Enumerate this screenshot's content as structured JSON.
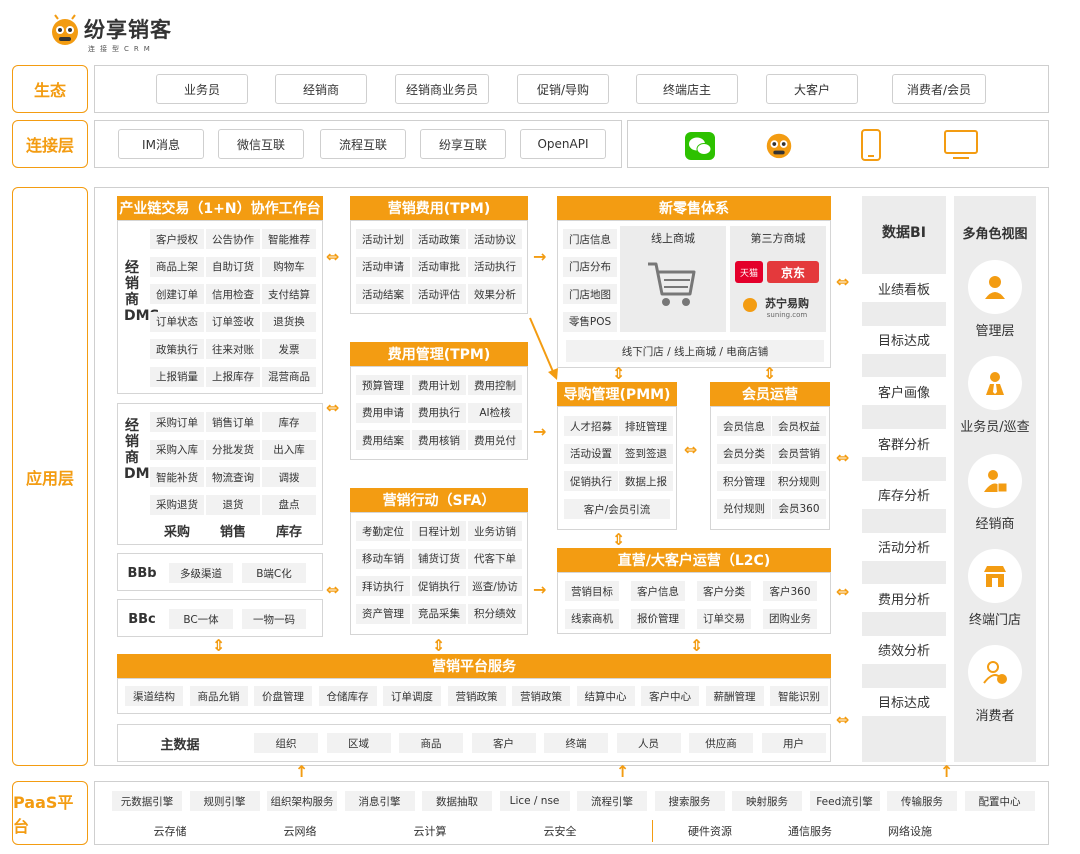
{
  "logo": {
    "name": "纷享销客",
    "sub": "连接型CRM"
  },
  "lanes": {
    "eco": "生态",
    "conn": "连接层",
    "app": "应用层",
    "paas": "PaaS平台"
  },
  "eco": [
    "业务员",
    "经销商",
    "经销商业务员",
    "促销/导购",
    "终端店主",
    "大客户",
    "消费者/会员"
  ],
  "conn": [
    "IM消息",
    "微信互联",
    "流程互联",
    "纷享互联",
    "OpenAPI"
  ],
  "conn_icons": [
    "wechat-icon",
    "mascot-icon",
    "mobile-icon",
    "monitor-icon"
  ],
  "chain": {
    "title": "产业链交易（1+N）协作工作台",
    "dms_label": "经销商DMS",
    "grid1": [
      "客户授权",
      "公告协作",
      "智能推荐",
      "商品上架",
      "自助订货",
      "购物车",
      "创建订单",
      "信用检查",
      "支付结算",
      "订单状态",
      "订单签收",
      "退货换",
      "政策执行",
      "往来对账",
      "发票",
      "上报销量",
      "上报库存",
      "混营商品"
    ],
    "grid2": [
      "采购订单",
      "销售订单",
      "库存",
      "采购入库",
      "分批发货",
      "出入库",
      "智能补货",
      "物流查询",
      "调拨",
      "采购退货",
      "退货",
      "盘点"
    ],
    "grid2_foot": [
      "采购",
      "销售",
      "库存"
    ],
    "bbb": {
      "label": "BBb",
      "items": [
        "多级渠道",
        "B端C化"
      ]
    },
    "bbc": {
      "label": "BBc",
      "items": [
        "BC一体",
        "一物一码"
      ]
    }
  },
  "tpm": {
    "title": "营销费用(TPM)",
    "items": [
      "活动计划",
      "活动政策",
      "活动协议",
      "活动申请",
      "活动审批",
      "活动执行",
      "活动结案",
      "活动评估",
      "效果分析"
    ]
  },
  "fee": {
    "title": "费用管理(TPM)",
    "items": [
      "预算管理",
      "费用计划",
      "费用控制",
      "费用申请",
      "费用执行",
      "AI检核",
      "费用结案",
      "费用核销",
      "费用兑付"
    ]
  },
  "sfa": {
    "title": "营销行动（SFA）",
    "items": [
      "考勤定位",
      "日程计划",
      "业务访销",
      "移动车销",
      "铺货订货",
      "代客下单",
      "拜访执行",
      "促销执行",
      "巡查/协访",
      "资产管理",
      "竞品采集",
      "积分绩效"
    ]
  },
  "retail": {
    "title": "新零售体系",
    "stores": [
      "门店信息",
      "门店分布",
      "门店地图",
      "零售POS"
    ],
    "online": "线上商城",
    "third": "第三方商城",
    "tmall": "天猫",
    "jd": "京东",
    "suning": "苏宁易购",
    "suning_en": "suning.com",
    "foot": "线下门店 / 线上商城 / 电商店铺"
  },
  "pmm": {
    "title": "导购管理(PMM)",
    "items": [
      "人才招募",
      "排班管理",
      "活动设置",
      "签到签退",
      "促销执行",
      "数据上报"
    ],
    "foot": "客户/会员引流"
  },
  "member": {
    "title": "会员运营",
    "items": [
      "会员信息",
      "会员权益",
      "会员分类",
      "会员营销",
      "积分管理",
      "积分规则",
      "兑付规则",
      "会员360"
    ]
  },
  "l2c": {
    "title": "直营/大客户运营（L2C)",
    "items": [
      "营销目标",
      "客户信息",
      "客户分类",
      "客户360",
      "线索商机",
      "报价管理",
      "订单交易",
      "团购业务"
    ]
  },
  "platform": {
    "title": "营销平台服务",
    "items": [
      "渠道结构",
      "商品允销",
      "价盘管理",
      "仓储库存",
      "订单调度",
      "营销政策",
      "营销政策",
      "结算中心",
      "客户中心",
      "薪酬管理",
      "智能识别"
    ]
  },
  "master": {
    "label": "主数据",
    "items": [
      "组织",
      "区域",
      "商品",
      "客户",
      "终端",
      "人员",
      "供应商",
      "用户"
    ]
  },
  "bi": {
    "title": "数据BI",
    "items": [
      "业绩看板",
      "目标达成",
      "客户画像",
      "客群分析",
      "库存分析",
      "活动分析",
      "费用分析",
      "绩效分析",
      "目标达成"
    ]
  },
  "roles": {
    "title": "多角色视图",
    "items": [
      {
        "label": "管理层",
        "icon": "manager-icon"
      },
      {
        "label": "业务员/巡查",
        "icon": "salesman-icon"
      },
      {
        "label": "经销商",
        "icon": "distributor-icon"
      },
      {
        "label": "终端门店",
        "icon": "store-icon"
      },
      {
        "label": "消费者",
        "icon": "consumer-icon"
      }
    ]
  },
  "paas": {
    "engines": [
      "元数据引擎",
      "规则引擎",
      "组织架构服务",
      "消息引擎",
      "数据抽取",
      "Lice / nse",
      "流程引擎",
      "搜索服务",
      "映射服务",
      "Feed流引擎",
      "传输服务",
      "配置中心"
    ],
    "infra": [
      "云存储",
      "云网络",
      "云计算",
      "云安全",
      "硬件资源",
      "通信服务",
      "网络设施"
    ]
  },
  "colors": {
    "accent": "#f39c12",
    "border": "#cfcfcf",
    "panel": "#ececec"
  }
}
